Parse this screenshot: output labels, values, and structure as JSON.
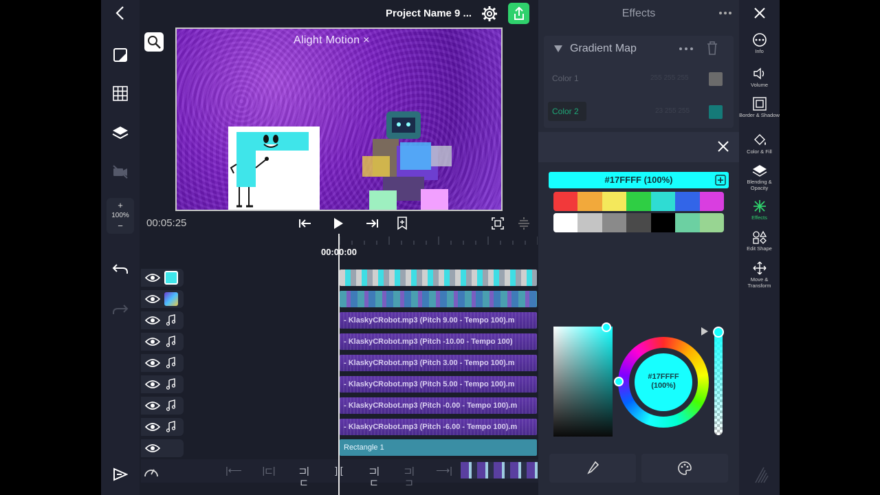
{
  "header": {
    "project_title": "Project Name 9 ...",
    "back_icon": "chevron-left-icon",
    "settings_icon": "gear-icon",
    "export_icon": "share-icon"
  },
  "left_toolbar": {
    "items": [
      "aspect-icon",
      "grid-icon",
      "layers-icon",
      "camera-off-icon"
    ],
    "zoom_plus": "+",
    "zoom_value": "100%",
    "zoom_minus": "−",
    "undo_icon": "undo-icon",
    "redo_icon": "redo-icon",
    "add_icon": "add-layer-icon"
  },
  "preview": {
    "watermark": "Alight Motion ×"
  },
  "transport": {
    "time": "00:05:25",
    "playhead_time": "00:00:00"
  },
  "tracks": [
    {
      "type": "image",
      "label": ""
    },
    {
      "type": "video",
      "label": ""
    },
    {
      "type": "audio",
      "label": "- KlaskyCRobot.mp3 (Pitch 9.00 - Tempo 100).m"
    },
    {
      "type": "audio",
      "label": "- KlaskyCRobot.mp3 (Pitch -10.00 - Tempo 100)"
    },
    {
      "type": "audio",
      "label": "- KlaskyCRobot.mp3 (Pitch 3.00 - Tempo 100).m"
    },
    {
      "type": "audio",
      "label": "- KlaskyCRobot.mp3 (Pitch 5.00 - Tempo 100).m"
    },
    {
      "type": "audio",
      "label": "- KlaskyCRobot.mp3 (Pitch -0.00 - Tempo 100).m"
    },
    {
      "type": "audio",
      "label": "- KlaskyCRobot.mp3 (Pitch -6.00 - Tempo 100).m"
    },
    {
      "type": "shape",
      "label": "Rectangle 1"
    }
  ],
  "effects_panel": {
    "title": "Effects",
    "effect_name": "Gradient Map",
    "color1_label": "Color 1",
    "color1_value": "255 255 255",
    "color2_label": "Color 2",
    "color2_value": "23 255 255"
  },
  "color_picker": {
    "hex_label": "#17FFFF (100%)",
    "center_hex": "#17FFFF",
    "center_alpha": "(100%)",
    "selected_color": "#17FFFF",
    "swatch_row1": [
      "#f2393a",
      "#f2a93b",
      "#f4e85b",
      "#2fce44",
      "#2fdcd3",
      "#3265e8",
      "#d93ee0"
    ],
    "swatch_row2": [
      "#ffffff",
      "#c4c4c4",
      "#8a8a8a",
      "#4a4a4a",
      "#000000",
      "#6cd0a2",
      "#98d592"
    ]
  },
  "right_bar": {
    "items": [
      {
        "icon": "info-icon",
        "label": "Info"
      },
      {
        "icon": "volume-icon",
        "label": "Volume"
      },
      {
        "icon": "border-icon",
        "label": "Border & Shadow"
      },
      {
        "icon": "fill-icon",
        "label": "Color & Fill"
      },
      {
        "icon": "blending-icon",
        "label": "Blending & Opacity"
      },
      {
        "icon": "effects-icon",
        "label": "Effects"
      },
      {
        "icon": "shape-icon",
        "label": "Edit Shape"
      },
      {
        "icon": "move-icon",
        "label": "Move & Transform"
      }
    ],
    "active": "Effects"
  }
}
